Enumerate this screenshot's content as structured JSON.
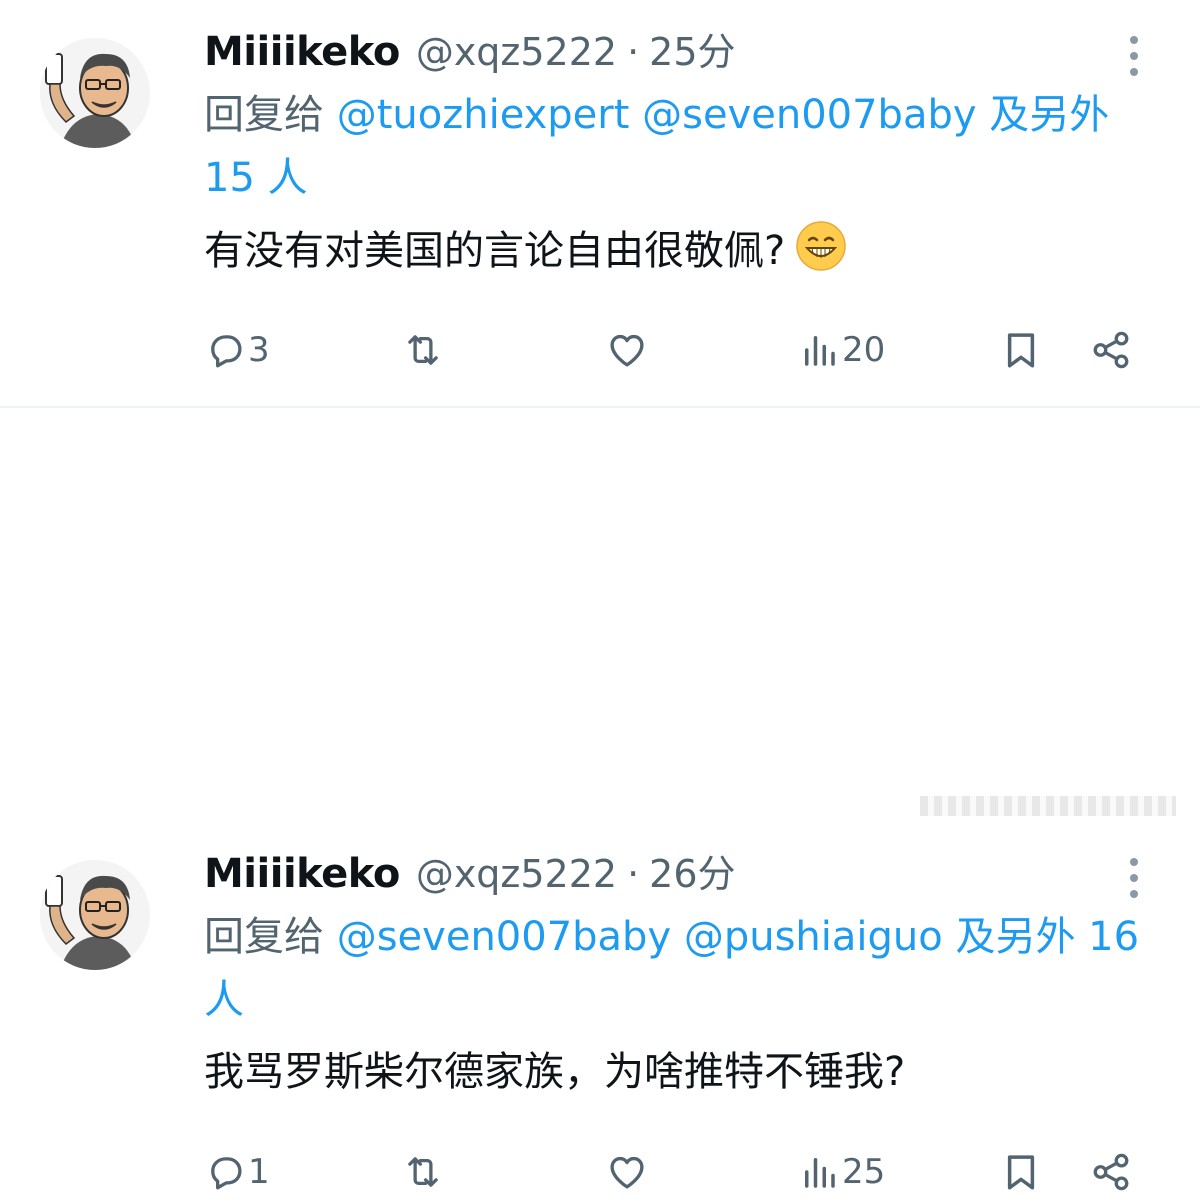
{
  "tweets": [
    {
      "display_name": "Miiiikeko",
      "handle": "@xqz5222",
      "separator": "·",
      "time": "25分",
      "reply_prefix": "回复给",
      "mentions": [
        "@tuozhiexpert",
        "@seven007baby"
      ],
      "reply_suffix": "及另外 15 人",
      "text": "有没有对美国的言论自由很敬佩?",
      "emoji": "grinning-squinting-face",
      "replies": "3",
      "retweets": "",
      "likes": "",
      "views": "20"
    },
    {
      "display_name": "Miiiikeko",
      "handle": "@xqz5222",
      "separator": "·",
      "time": "26分",
      "reply_prefix": "回复给",
      "mentions": [
        "@seven007baby",
        "@pushiaiguo"
      ],
      "reply_suffix": "及另外 16 人",
      "text": "我骂罗斯柴尔德家族，为啥推特不锤我?",
      "replies": "1",
      "retweets": "",
      "likes": "",
      "views": "25"
    }
  ],
  "icons": {
    "reply": "reply-icon",
    "retweet": "retweet-icon",
    "like": "heart-icon",
    "views": "views-icon",
    "bookmark": "bookmark-icon",
    "share": "share-icon",
    "more": "more-vertical-icon"
  },
  "colors": {
    "text": "#0f1419",
    "secondary": "#536471",
    "accent": "#1d9bf0",
    "divider": "#eff3f4"
  }
}
